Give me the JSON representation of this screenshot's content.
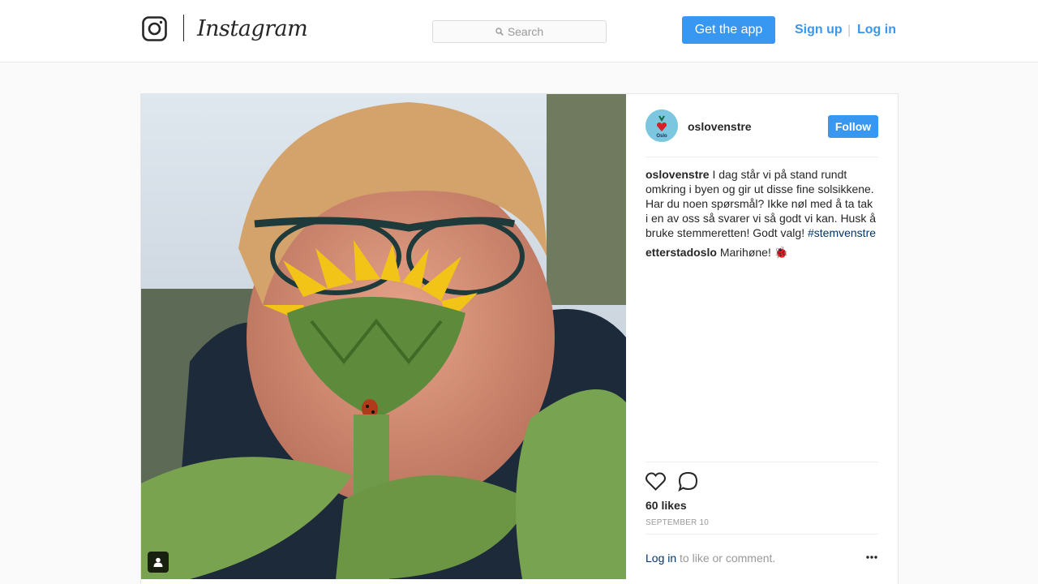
{
  "header": {
    "wordmark": "Instagram",
    "search_placeholder": "Search",
    "get_app_label": "Get the app",
    "signup_label": "Sign up",
    "separator": "|",
    "login_label": "Log in"
  },
  "post": {
    "username": "oslovenstre",
    "follow_label": "Follow",
    "avatar_text": "Oslo",
    "caption": {
      "user": "oslovenstre",
      "text": "I dag står vi på stand rundt omkring i byen og gir ut disse fine solsikkene. Har du noen spørsmål? Ikke nøl med å ta tak i en av oss så svarer vi så godt vi kan. Husk å bruke stemmeretten! Godt valg!",
      "hashtag": "#stemvenstre"
    },
    "comments": [
      {
        "user": "etterstadoslo",
        "text": "Marihøne! 🐞"
      }
    ],
    "likes": "60 likes",
    "date": "SEPTEMBER 10",
    "footer_login": "Log in",
    "footer_text": " to like or comment."
  },
  "colors": {
    "accent": "#3897f0",
    "link_dark": "#003569"
  }
}
